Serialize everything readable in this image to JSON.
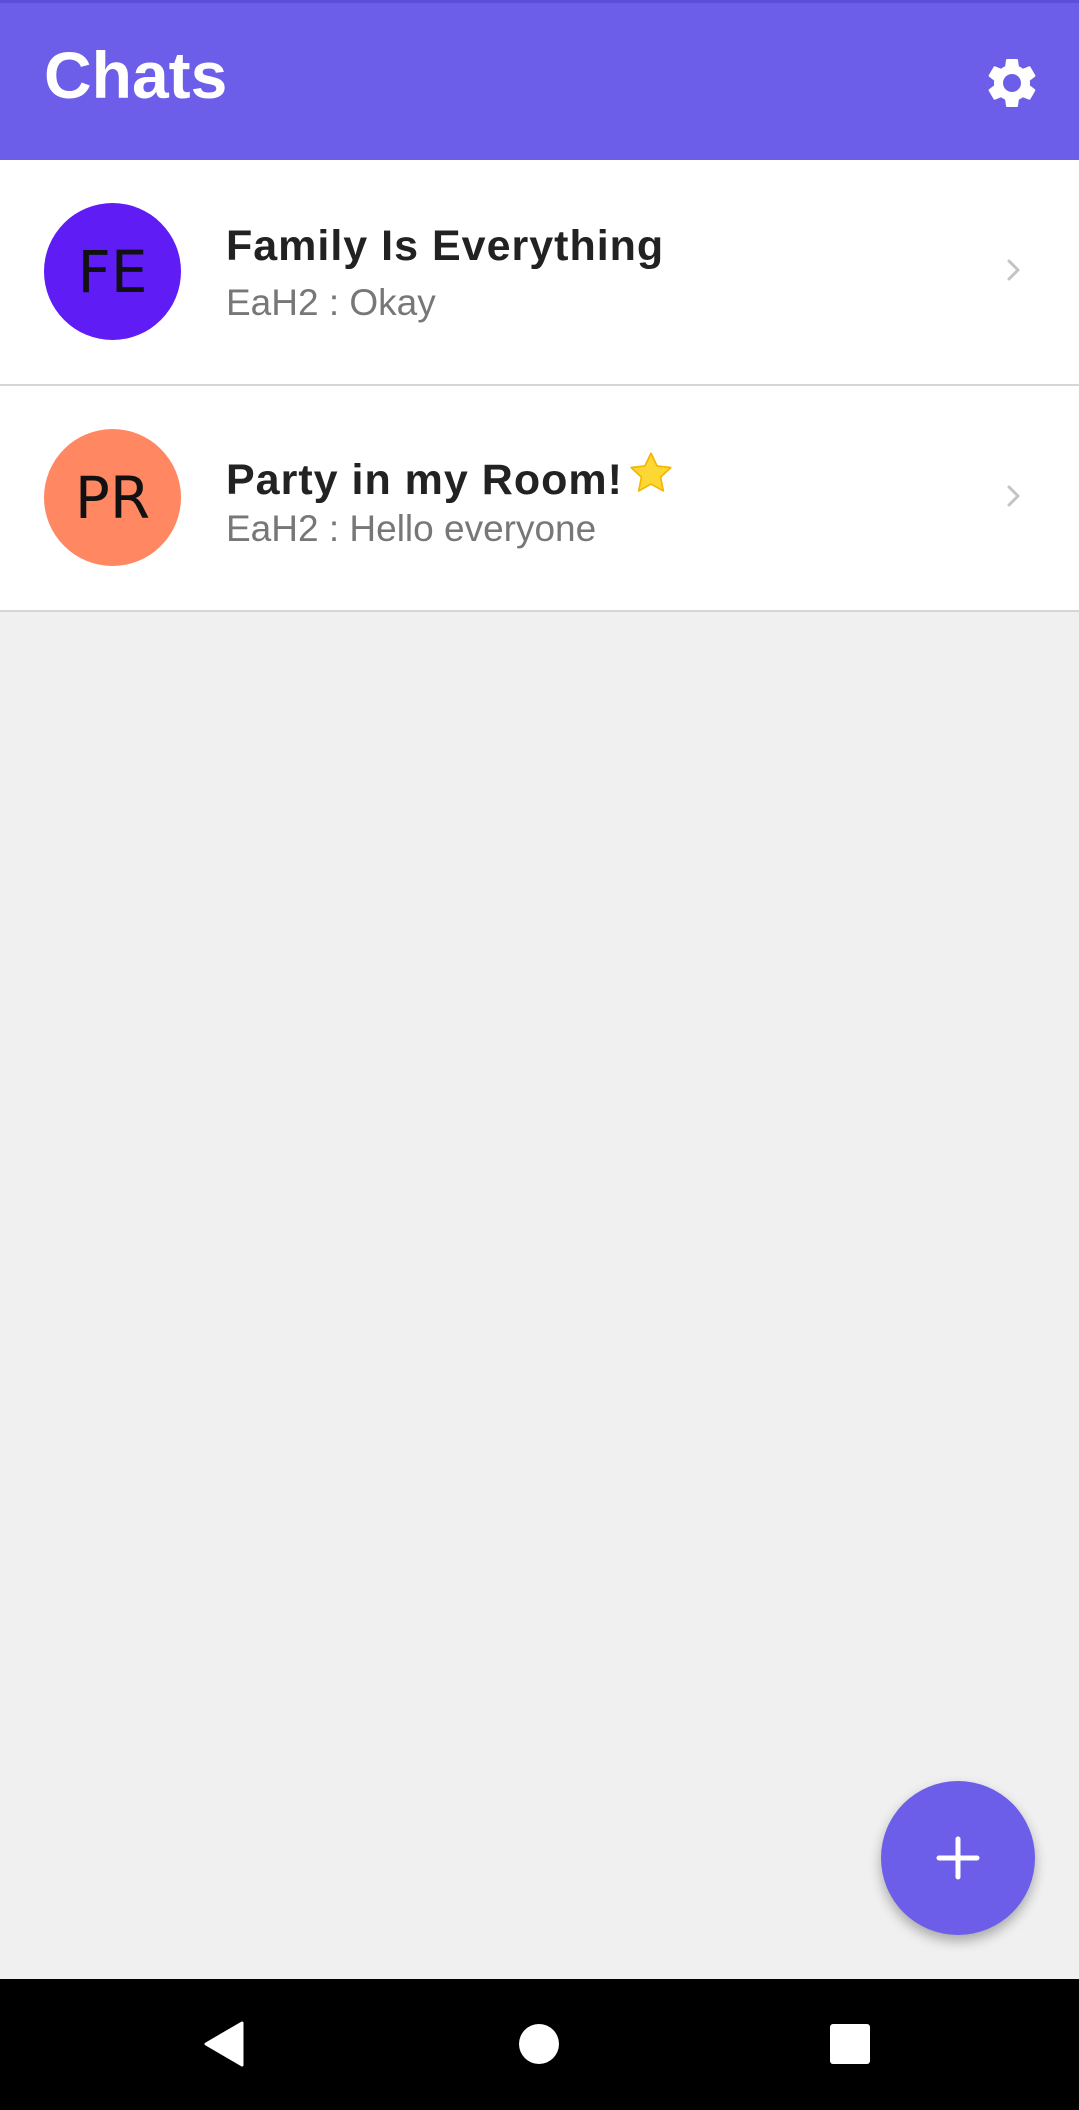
{
  "app_bar": {
    "title": "Chats",
    "icon": "gear-icon",
    "background": "#6c5ee8"
  },
  "chats": [
    {
      "initials": "FE",
      "avatar_color": "#5f1cf5",
      "name": "Family Is Everything",
      "preview": "EaH2 : Okay",
      "starred": false
    },
    {
      "initials": "PR",
      "avatar_color": "#ff8863",
      "name": "Party in my Room!",
      "preview": "EaH2 : Hello everyone",
      "starred": true
    }
  ],
  "fab": {
    "icon": "plus-icon",
    "background": "#6c5ee8"
  },
  "nav": {
    "back_icon": "back-triangle-icon",
    "home_icon": "home-circle-icon",
    "recents_icon": "recents-square-icon"
  }
}
